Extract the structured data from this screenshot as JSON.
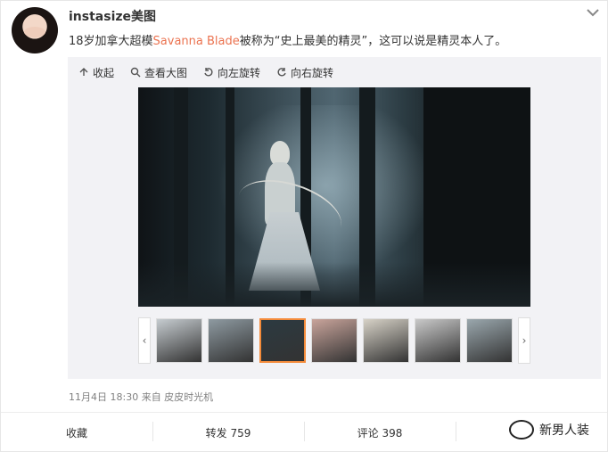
{
  "post": {
    "username": "instasize美图",
    "text_before": "18岁加拿大超模",
    "text_highlight": "Savanna Blade",
    "text_after": "被称为“史上最美的精灵”，这可以说是精灵本人了。",
    "meta": "11月4日 18:30 来自 皮皮时光机"
  },
  "toolbar": {
    "collapse": "收起",
    "view_large": "查看大图",
    "rotate_left": "向左旋转",
    "rotate_right": "向右旋转"
  },
  "thumbnails": {
    "prev_icon": "‹",
    "next_icon": "›",
    "active_index": 2,
    "colors": [
      "#c6ccd0",
      "#8e9aa1",
      "#2c3a41",
      "#c9a49b",
      "#d7d2c7",
      "#c9c9c9",
      "#9aa7ad"
    ]
  },
  "actions": {
    "favorite": "收藏",
    "repost": "转发 759",
    "comment": "评论 398",
    "like": ""
  },
  "watermark": "新男人装",
  "colors": {
    "highlight": "#eb7350",
    "active_thumb_border": "#f48b3a"
  }
}
